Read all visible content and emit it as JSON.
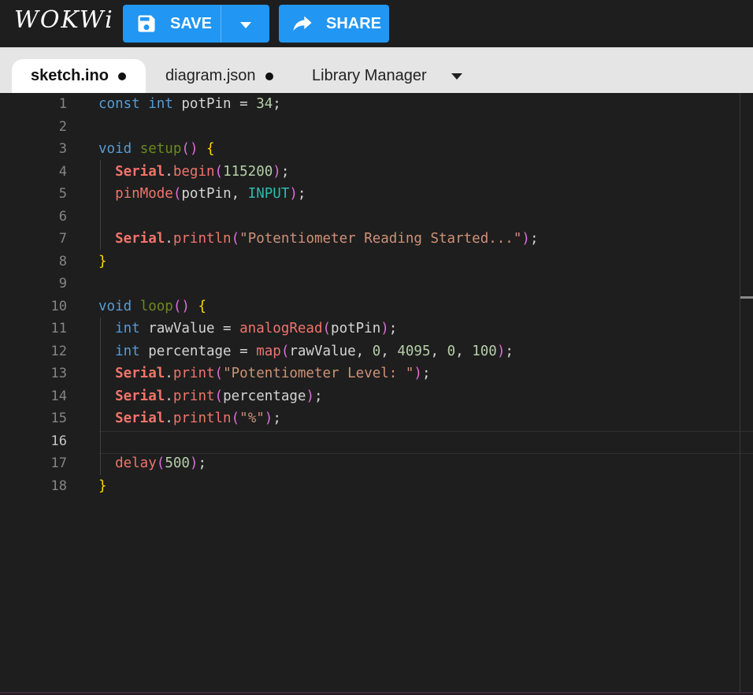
{
  "header": {
    "logo": "WOKWi",
    "save_label": "SAVE",
    "share_label": "SHARE",
    "icons": {
      "save": "floppy-disk-icon",
      "dropdown": "caret-down-icon",
      "share": "share-arrow-icon"
    }
  },
  "tabs": [
    {
      "label": "sketch.ino",
      "unsaved": true,
      "active": true
    },
    {
      "label": "diagram.json",
      "unsaved": true,
      "active": false
    },
    {
      "label": "Library Manager",
      "active": false
    }
  ],
  "editor": {
    "current_line": 16,
    "line_numbers": [
      "1",
      "2",
      "3",
      "4",
      "5",
      "6",
      "7",
      "8",
      "9",
      "10",
      "11",
      "12",
      "13",
      "14",
      "15",
      "16",
      "17",
      "18"
    ],
    "lines": [
      "const int potPin = 34;",
      "",
      "void setup() {",
      "  Serial.begin(115200);",
      "  pinMode(potPin, INPUT);",
      "",
      "  Serial.println(\"Potentiometer Reading Started...\");",
      "}",
      "",
      "void loop() {",
      "  int rawValue = analogRead(potPin);",
      "  int percentage = map(rawValue, 0, 4095, 0, 100);",
      "  Serial.print(\"Potentiometer Level: \");",
      "  Serial.print(percentage);",
      "  Serial.println(\"%\");",
      "",
      "  delay(500);",
      "}"
    ]
  },
  "colors": {
    "accent": "#2196f3",
    "keyword": "#569cd6",
    "class": "#f0746b",
    "string": "#ce9178",
    "number": "#b5cea8",
    "bracket": "#ffd700",
    "paren": "#da70d6",
    "constant": "#2fb8b0"
  }
}
